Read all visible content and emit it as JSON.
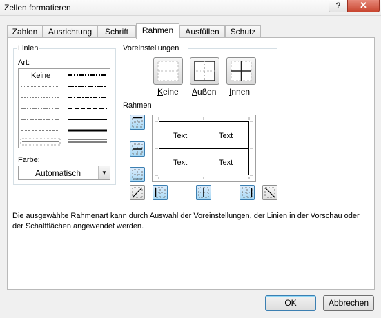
{
  "window": {
    "title": "Zellen formatieren",
    "help_glyph": "?",
    "close_glyph": "✕"
  },
  "tabs": [
    {
      "label": "Zahlen"
    },
    {
      "label": "Ausrichtung"
    },
    {
      "label": "Schrift"
    },
    {
      "label": "Rahmen",
      "active": true
    },
    {
      "label": "Ausfüllen"
    },
    {
      "label": "Schutz"
    }
  ],
  "lines": {
    "group_label": "Linien",
    "style_label_hotkey": "A",
    "style_label_rest": "rt:",
    "none_label": "Keine",
    "color_label_hotkey": "F",
    "color_label_rest": "arbe:",
    "color_value": "Automatisch"
  },
  "presets": {
    "group_label": "Voreinstellungen",
    "items": [
      {
        "hotkey": "K",
        "rest": "eine"
      },
      {
        "hotkey": "A",
        "rest": "ußen"
      },
      {
        "hotkey": "I",
        "rest": "nnen"
      }
    ]
  },
  "border": {
    "group_label": "Rahmen",
    "cells": [
      "Text",
      "Text",
      "Text",
      "Text"
    ]
  },
  "info_text": "Die ausgewählte Rahmenart kann durch Auswahl der Voreinstellungen, der Linien in der Vorschau oder der Schaltflächen angewendet werden.",
  "buttons": {
    "ok": "OK",
    "cancel": "Abbrechen"
  },
  "colors": {
    "accent": "#3c7fb1",
    "selected_button": "#a7d9f5",
    "close_button": "#c8452f"
  }
}
